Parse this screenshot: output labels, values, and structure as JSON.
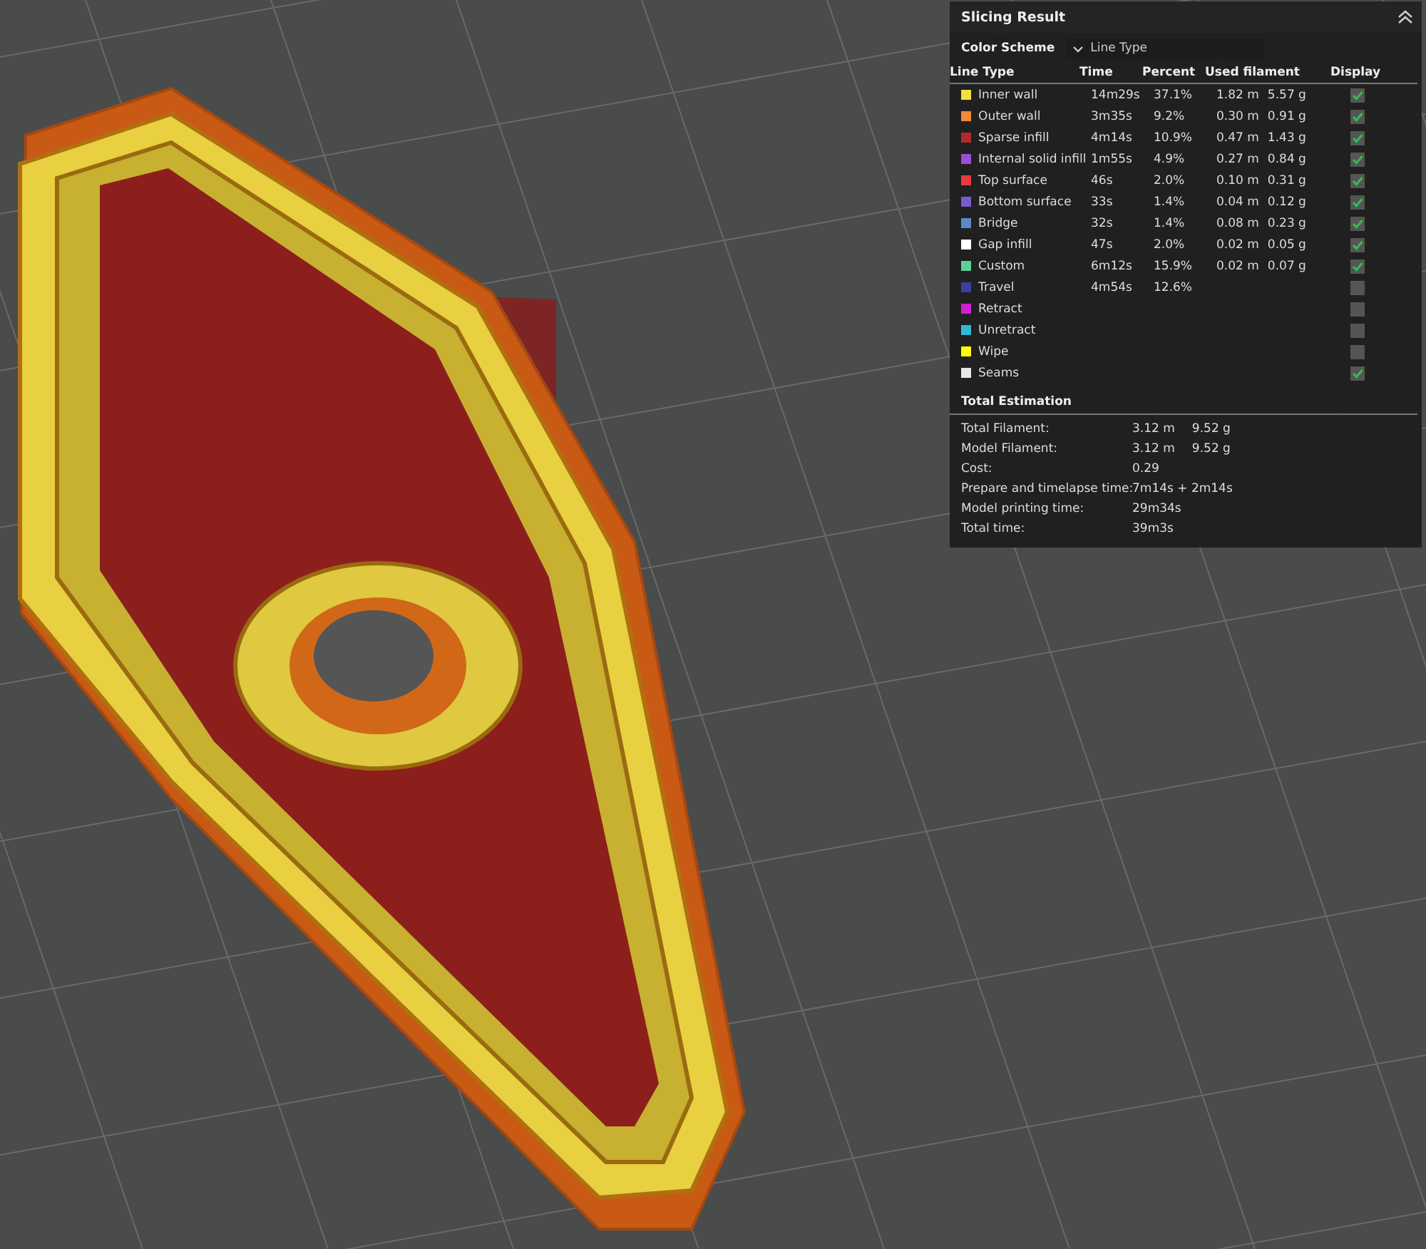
{
  "panel": {
    "title": "Slicing Result",
    "color_scheme": {
      "label": "Color Scheme",
      "value": "Line Type"
    },
    "columns": [
      "Line Type",
      "Time",
      "Percent",
      "Used filament",
      "Display"
    ],
    "rows": [
      {
        "color": "#f2e040",
        "label": "Inner wall",
        "time": "14m29s",
        "percent": "37.1%",
        "length": "1.82 m",
        "weight": "5.57 g",
        "checked": true
      },
      {
        "color": "#f5873a",
        "label": "Outer wall",
        "time": "3m35s",
        "percent": "9.2%",
        "length": "0.30 m",
        "weight": "0.91 g",
        "checked": true
      },
      {
        "color": "#b02a28",
        "label": "Sparse infill",
        "time": "4m14s",
        "percent": "10.9%",
        "length": "0.47 m",
        "weight": "1.43 g",
        "checked": true
      },
      {
        "color": "#9a50d0",
        "label": "Internal solid infill",
        "time": "1m55s",
        "percent": "4.9%",
        "length": "0.27 m",
        "weight": "0.84 g",
        "checked": true
      },
      {
        "color": "#e83c3c",
        "label": "Top surface",
        "time": "46s",
        "percent": "2.0%",
        "length": "0.10 m",
        "weight": "0.31 g",
        "checked": true
      },
      {
        "color": "#7a5ad0",
        "label": "Bottom surface",
        "time": "33s",
        "percent": "1.4%",
        "length": "0.04 m",
        "weight": "0.12 g",
        "checked": true
      },
      {
        "color": "#5a88c8",
        "label": "Bridge",
        "time": "32s",
        "percent": "1.4%",
        "length": "0.08 m",
        "weight": "0.23 g",
        "checked": true
      },
      {
        "color": "#ffffff",
        "label": "Gap infill",
        "time": "47s",
        "percent": "2.0%",
        "length": "0.02 m",
        "weight": "0.05 g",
        "checked": true
      },
      {
        "color": "#5ecf98",
        "label": "Custom",
        "time": "6m12s",
        "percent": "15.9%",
        "length": "0.02 m",
        "weight": "0.07 g",
        "checked": true
      },
      {
        "color": "#3a40a0",
        "label": "Travel",
        "time": "4m54s",
        "percent": "12.6%",
        "checked": false
      },
      {
        "color": "#d020d0",
        "label": "Retract",
        "checked": false
      },
      {
        "color": "#30b8d8",
        "label": "Unretract",
        "checked": false
      },
      {
        "color": "#ffff00",
        "label": "Wipe",
        "checked": false
      },
      {
        "color": "#e6e6e6",
        "label": "Seams",
        "checked": true
      }
    ],
    "total_estimation": {
      "title": "Total Estimation",
      "items": [
        {
          "label": "Total Filament:",
          "values": [
            "3.12 m",
            "9.52 g"
          ]
        },
        {
          "label": "Model Filament:",
          "values": [
            "3.12 m",
            "9.52 g"
          ]
        },
        {
          "label": "Cost:",
          "values": [
            "0.29"
          ]
        },
        {
          "label": "Prepare and timelapse time:",
          "values": [
            "7m14s + 2m14s"
          ]
        },
        {
          "label": "Model printing time:",
          "values": [
            "29m34s"
          ]
        },
        {
          "label": "Total time:",
          "values": [
            "39m3s"
          ]
        }
      ]
    }
  }
}
